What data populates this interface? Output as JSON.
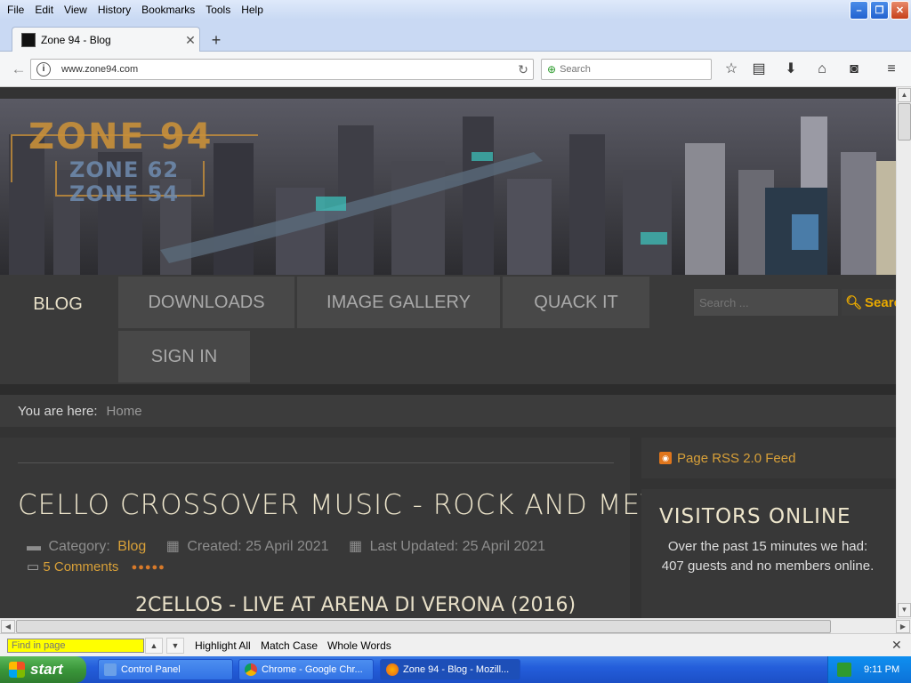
{
  "browser": {
    "menu": [
      "File",
      "Edit",
      "View",
      "History",
      "Bookmarks",
      "Tools",
      "Help"
    ],
    "tab_title": "Zone 94 - Blog",
    "url": "www.zone94.com",
    "search_placeholder": "Search"
  },
  "site": {
    "logo_main": "ZONE 94",
    "logo_sub1": "ZONE 62",
    "logo_sub2": "ZONE 54",
    "nav": [
      "BLOG",
      "DOWNLOADS",
      "IMAGE GALLERY",
      "QUACK IT",
      "SIGN IN"
    ],
    "search_placeholder": "Search ...",
    "search_button": "Search",
    "breadcrumb_label": "You are here:",
    "breadcrumb_home": "Home"
  },
  "article": {
    "title": "CELLO CROSSOVER MUSIC - ROCK AND METAL",
    "category_label": "Category:",
    "category": "Blog",
    "created": "Created: 25 April 2021",
    "updated": "Last Updated: 25 April 2021",
    "comments": "5 Comments",
    "subheading": "2CELLOS - LIVE AT ARENA DI VERONA (2016)"
  },
  "sidebar": {
    "rss": "Page RSS 2.0 Feed",
    "visitors_title": "VISITORS ONLINE",
    "visitors_text": "Over the past 15 minutes we had: 407 guests and no members online."
  },
  "findbar": {
    "placeholder": "Find in page",
    "highlight_all": "Highlight All",
    "match_case": "Match Case",
    "whole_words": "Whole Words"
  },
  "taskbar": {
    "start": "start",
    "tasks": [
      "Control Panel",
      "Chrome - Google Chr...",
      "Zone 94 - Blog - Mozill..."
    ],
    "clock": "9:11 PM"
  }
}
